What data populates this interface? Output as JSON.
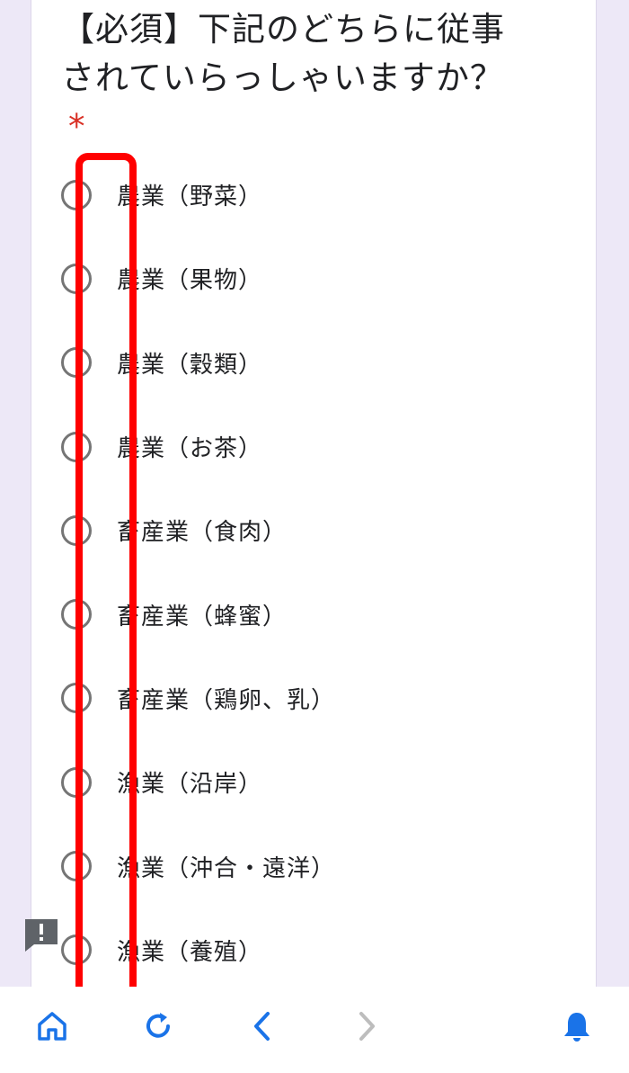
{
  "question": {
    "text": "【必須】下記のどちらに従事されていらっしゃいますか？",
    "required_mark": "*"
  },
  "options": [
    "農業（野菜）",
    "農業（果物）",
    "農業（穀類）",
    "農業（お茶）",
    "畜産業（食肉）",
    "畜産業（蜂蜜）",
    "畜産業（鶏卵、乳）",
    "漁業（沿岸）",
    "漁業（沖合・遠洋）",
    "漁業（養殖）"
  ],
  "colors": {
    "accent": "#1a73e8",
    "highlight": "#ff0000",
    "required": "#d93025",
    "radio_border": "#757575",
    "background": "#ede8f7",
    "disabled": "#bdbdbd"
  },
  "icons": {
    "feedback": "feedback-icon",
    "home": "home-icon",
    "reload": "reload-icon",
    "back": "chevron-left-icon",
    "forward": "chevron-right-icon",
    "notifications": "bell-icon"
  }
}
